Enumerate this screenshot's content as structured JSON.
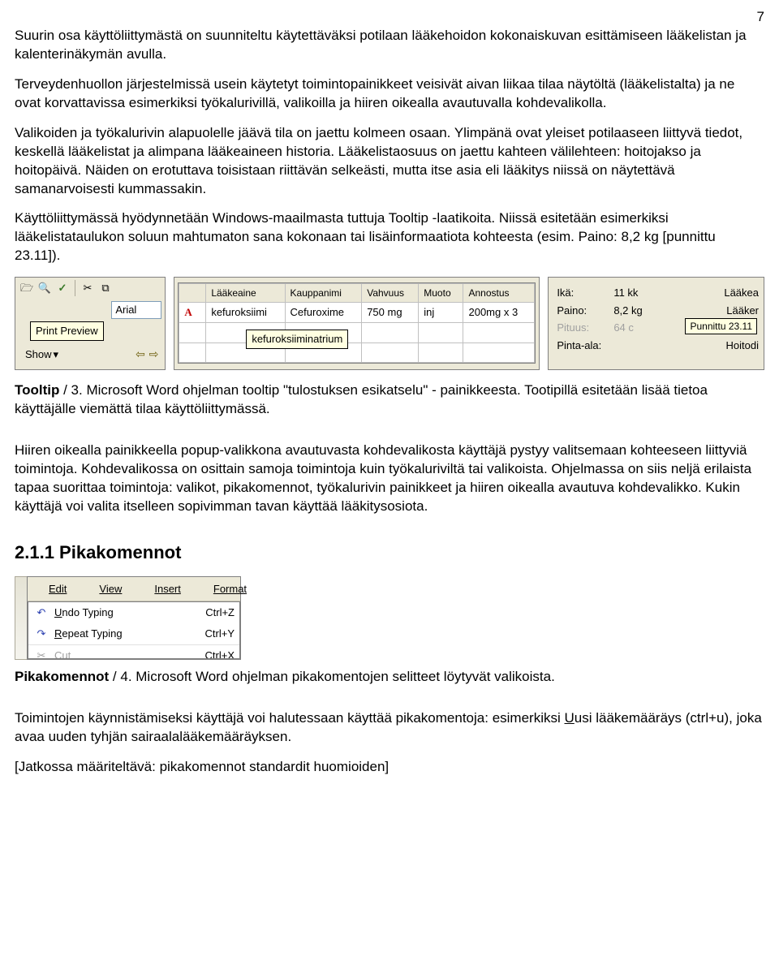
{
  "page_number": "7",
  "para1": "Suurin osa käyttöliittymästä on suunniteltu käytettäväksi potilaan lääkehoidon kokonaiskuvan esittämiseen lääkelistan ja kalenterinäkymän avulla.",
  "para2": "Terveydenhuollon järjestelmissä usein käytetyt toimintopainikkeet veisivät aivan liikaa tilaa näytöltä (lääkelistalta) ja ne ovat korvattavissa esimerkiksi työkalurivillä, valikoilla ja hiiren oikealla avautuvalla kohdevalikolla.",
  "para3": "Valikoiden ja työkalurivin alapuolelle jäävä tila on jaettu kolmeen osaan. Ylimpänä ovat yleiset potilaaseen liittyvä tiedot, keskellä lääkelistat ja alimpana lääkeaineen historia. Lääkelistaosuus on jaettu kahteen välilehteen: hoitojakso ja hoitopäivä. Näiden on erotuttava toisistaan riittävän selkeästi, mutta itse asia eli lääkitys niissä on näytettävä samanarvoisesti kummassakin.",
  "para4": "Käyttöliittymässä hyödynnetään Windows-maailmasta tuttuja Tooltip -laatikoita. Niissä esitetään esimerkiksi lääkelistataulukon soluun mahtumaton sana kokonaan tai lisäinformaatiota kohteesta (esim. Paino: 8,2 kg [punnittu 23.11]).",
  "toolbar": {
    "font": "Arial",
    "show_label": "Show",
    "tooltip": "Print Preview"
  },
  "table": {
    "headers": {
      "c0": "",
      "c1": "Lääkeaine",
      "c2": "Kauppanimi",
      "c3": "Vahvuus",
      "c4": "Muoto",
      "c5": "Annostus"
    },
    "row": {
      "marker": "A",
      "c1": "kefuroksiimi",
      "c2": "Cefuroxime",
      "c3": "750 mg",
      "c4": "inj",
      "c5": "200mg x 3"
    },
    "tooltip": "kefuroksiiminatrium"
  },
  "info": {
    "r1": {
      "k": "Ikä:",
      "v": "11 kk",
      "right": "Lääkea"
    },
    "r2": {
      "k": "Paino:",
      "v": "8,2 kg",
      "right": "Lääker"
    },
    "r3": {
      "k": "Pituus:",
      "v": "64 c",
      "right": ""
    },
    "r4": {
      "k": "Pinta-ala:",
      "v": "",
      "right": "Hoitodi"
    },
    "tooltip": "Punnittu 23.11"
  },
  "caption1_b": "Tooltip",
  "caption1_rest": " / 3. Microsoft Word ohjelman tooltip \"tulostuksen esikatselu\" - painikkeesta. Tootipillä esitetään lisää tietoa käyttäjälle viemättä tilaa käyttöliittymässä.",
  "para5": "Hiiren oikealla painikkeella popup-valikkona avautuvasta kohdevalikosta käyttäjä pystyy valitsemaan kohteeseen liittyviä toimintoja. Kohdevalikossa on osittain samoja toimintoja kuin työkaluriviltä tai valikoista. Ohjelmassa on siis neljä erilaista tapaa suorittaa toimintoja: valikot, pikakomennot, työkalurivin painikkeet ja hiiren oikealla avautuva kohdevalikko. Kukin käyttäjä voi valita itselleen sopivimman tavan käyttää lääkitysosiota.",
  "heading": "2.1.1  Pikakomennot",
  "menu": {
    "bar": {
      "edit": "Edit",
      "view": "View",
      "insert": "Insert",
      "format": "Format"
    },
    "items": {
      "undo": {
        "label_pre": "U",
        "label_rest": "ndo Typing",
        "shortcut": "Ctrl+Z"
      },
      "repeat": {
        "label_pre": "R",
        "label_rest": "epeat Typing",
        "shortcut": "Ctrl+Y"
      },
      "cut": {
        "label": "Cut",
        "shortcut": "Ctrl+X"
      }
    }
  },
  "caption2_b": "Pikakomennot",
  "caption2_rest": " / 4. Microsoft Word ohjelman pikakomentojen selitteet löytyvät valikoista.",
  "para6_pre": "Toimintojen käynnistämiseksi käyttäjä voi halutessaan käyttää pikakomentoja: esimerkiksi ",
  "para6_u": "U",
  "para6_post": "usi lääkemääräys (ctrl+u), joka avaa uuden tyhjän sairaalalääkemääräyksen.",
  "para7": "[Jatkossa määriteltävä: pikakomennot standardit huomioiden]"
}
